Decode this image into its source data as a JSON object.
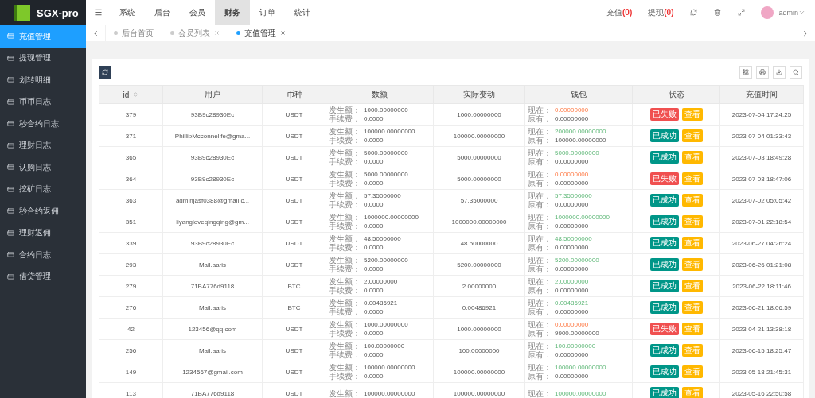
{
  "brand": {
    "name": "SGX-pro"
  },
  "top_nav": [
    {
      "label": "系统",
      "selected": false
    },
    {
      "label": "后台",
      "selected": false
    },
    {
      "label": "会员",
      "selected": false
    },
    {
      "label": "财务",
      "selected": true
    },
    {
      "label": "订单",
      "selected": false
    },
    {
      "label": "统计",
      "selected": false
    }
  ],
  "top_right": {
    "links": [
      {
        "label": "充值",
        "count": "(0)"
      },
      {
        "label": "提现",
        "count": "(0)"
      }
    ],
    "user": "admin"
  },
  "sidebar": [
    {
      "label": "充值管理",
      "selected": true
    },
    {
      "label": "提现管理",
      "selected": false
    },
    {
      "label": "划转明细",
      "selected": false
    },
    {
      "label": "币币日志",
      "selected": false
    },
    {
      "label": "秒合约日志",
      "selected": false
    },
    {
      "label": "理财日志",
      "selected": false
    },
    {
      "label": "认购日志",
      "selected": false
    },
    {
      "label": "挖矿日志",
      "selected": false
    },
    {
      "label": "秒合约返佣",
      "selected": false
    },
    {
      "label": "理财返佣",
      "selected": false
    },
    {
      "label": "合约日志",
      "selected": false
    },
    {
      "label": "借贷管理",
      "selected": false
    }
  ],
  "page_tabs": [
    {
      "label": "后台首页",
      "selected": false,
      "closable": false
    },
    {
      "label": "会员列表",
      "selected": false,
      "closable": true
    },
    {
      "label": "充值管理",
      "selected": true,
      "closable": true
    }
  ],
  "table": {
    "columns": [
      "id",
      "用户",
      "币种",
      "数额",
      "实际变动",
      "钱包",
      "状态",
      "充值时间"
    ],
    "rows": [
      {
        "id": "379",
        "user": "93B9c28930Ec",
        "coin": "USDT",
        "amount_label": "发生额：",
        "amount": "1000.00000000",
        "fee_label": "手续费：",
        "fee": "0.0000",
        "change": "1000.00000000",
        "now_label": "现在：",
        "now": "0.00000000",
        "before_label": "原有：",
        "before": "0.00000000",
        "kind": "failed",
        "status_label": "已失败",
        "view": "查看",
        "time": "2023-07-04 17:24:25"
      },
      {
        "id": "371",
        "user": "PhillipMcconnellfe@gma...",
        "coin": "USDT",
        "amount_label": "发生额：",
        "amount": "100000.00000000",
        "fee_label": "手续费：",
        "fee": "0.0000",
        "change": "100000.00000000",
        "now_label": "现在：",
        "now": "200000.00000000",
        "before_label": "原有：",
        "before": "100000.00000000",
        "kind": "success",
        "status_label": "已成功",
        "view": "查看",
        "time": "2023-07-04 01:33:43"
      },
      {
        "id": "365",
        "user": "93B9c28930Ec",
        "coin": "USDT",
        "amount_label": "发生额：",
        "amount": "5000.00000000",
        "fee_label": "手续费：",
        "fee": "0.0000",
        "change": "5000.00000000",
        "now_label": "现在：",
        "now": "5000.00000000",
        "before_label": "原有：",
        "before": "0.00000000",
        "kind": "success",
        "status_label": "已成功",
        "view": "查看",
        "time": "2023-07-03 18:49:28"
      },
      {
        "id": "364",
        "user": "93B9c28930Ec",
        "coin": "USDT",
        "amount_label": "发生额：",
        "amount": "5000.00000000",
        "fee_label": "手续费：",
        "fee": "0.0000",
        "change": "5000.00000000",
        "now_label": "现在：",
        "now": "0.00000000",
        "before_label": "原有：",
        "before": "0.00000000",
        "kind": "failed",
        "status_label": "已失败",
        "view": "查看",
        "time": "2023-07-03 18:47:06"
      },
      {
        "id": "363",
        "user": "adminjasf0388@gmail.c...",
        "coin": "USDT",
        "amount_label": "发生额：",
        "amount": "57.35000000",
        "fee_label": "手续费：",
        "fee": "0.0000",
        "change": "57.35000000",
        "now_label": "现在：",
        "now": "57.35000000",
        "before_label": "原有：",
        "before": "0.00000000",
        "kind": "success",
        "status_label": "已成功",
        "view": "查看",
        "time": "2023-07-02 05:05:42"
      },
      {
        "id": "351",
        "user": "liyangloveqingqing@gm...",
        "coin": "USDT",
        "amount_label": "发生额：",
        "amount": "1000000.00000000",
        "fee_label": "手续费：",
        "fee": "0.0000",
        "change": "1000000.00000000",
        "now_label": "现在：",
        "now": "1000000.00000000",
        "before_label": "原有：",
        "before": "0.00000000",
        "kind": "success",
        "status_label": "已成功",
        "view": "查看",
        "time": "2023-07-01 22:18:54"
      },
      {
        "id": "339",
        "user": "93B9c28930Ec",
        "coin": "USDT",
        "amount_label": "发生额：",
        "amount": "48.50000000",
        "fee_label": "手续费：",
        "fee": "0.0000",
        "change": "48.50000000",
        "now_label": "现在：",
        "now": "48.50000000",
        "before_label": "原有：",
        "before": "0.00000000",
        "kind": "success",
        "status_label": "已成功",
        "view": "查看",
        "time": "2023-06-27 04:26:24"
      },
      {
        "id": "293",
        "user": "Mail.aaris",
        "coin": "USDT",
        "amount_label": "发生额：",
        "amount": "5200.00000000",
        "fee_label": "手续费：",
        "fee": "0.0000",
        "change": "5200.00000000",
        "now_label": "现在：",
        "now": "5200.00000000",
        "before_label": "原有：",
        "before": "0.00000000",
        "kind": "success",
        "status_label": "已成功",
        "view": "查看",
        "time": "2023-06-26 01:21:08"
      },
      {
        "id": "279",
        "user": "71BA776d9118",
        "coin": "BTC",
        "amount_label": "发生额：",
        "amount": "2.00000000",
        "fee_label": "手续费：",
        "fee": "0.0000",
        "change": "2.00000000",
        "now_label": "现在：",
        "now": "2.00000000",
        "before_label": "原有：",
        "before": "0.00000000",
        "kind": "success",
        "status_label": "已成功",
        "view": "查看",
        "time": "2023-06-22 18:11:46"
      },
      {
        "id": "276",
        "user": "Mail.aaris",
        "coin": "BTC",
        "amount_label": "发生额：",
        "amount": "0.00486921",
        "fee_label": "手续费：",
        "fee": "0.0000",
        "change": "0.00486921",
        "now_label": "现在：",
        "now": "0.00486921",
        "before_label": "原有：",
        "before": "0.00000000",
        "kind": "success",
        "status_label": "已成功",
        "view": "查看",
        "time": "2023-06-21 18:06:59"
      },
      {
        "id": "42",
        "user": "123456@qq.com",
        "coin": "USDT",
        "amount_label": "发生额：",
        "amount": "1000.00000000",
        "fee_label": "手续费：",
        "fee": "0.0000",
        "change": "1000.00000000",
        "now_label": "现在：",
        "now": "0.00000000",
        "before_label": "原有：",
        "before": "9900.00000000",
        "kind": "failed",
        "status_label": "已失败",
        "view": "查看",
        "time": "2023-04-21 13:38:18"
      },
      {
        "id": "256",
        "user": "Mail.aaris",
        "coin": "USDT",
        "amount_label": "发生额：",
        "amount": "100.00000000",
        "fee_label": "手续费：",
        "fee": "0.0000",
        "change": "100.00000000",
        "now_label": "现在：",
        "now": "100.00000000",
        "before_label": "原有：",
        "before": "0.00000000",
        "kind": "success",
        "status_label": "已成功",
        "view": "查看",
        "time": "2023-06-15 18:25:47"
      },
      {
        "id": "149",
        "user": "1234567@gmail.com",
        "coin": "USDT",
        "amount_label": "发生额：",
        "amount": "100000.00000000",
        "fee_label": "手续费：",
        "fee": "0.0000",
        "change": "100000.00000000",
        "now_label": "现在：",
        "now": "100000.00000000",
        "before_label": "原有：",
        "before": "0.00000000",
        "kind": "success",
        "status_label": "已成功",
        "view": "查看",
        "time": "2023-05-18 21:45:31"
      },
      {
        "id": "113",
        "user": "71BA776d9118",
        "coin": "USDT",
        "amount_label": "发生额：",
        "amount": "100000.00000000",
        "change": "100000.00000000",
        "now_label": "现在：",
        "now": "100000.00000000",
        "kind": "success",
        "status_label": "已成功",
        "view": "查看",
        "time": "2023-05-16 22:50:58"
      }
    ]
  }
}
